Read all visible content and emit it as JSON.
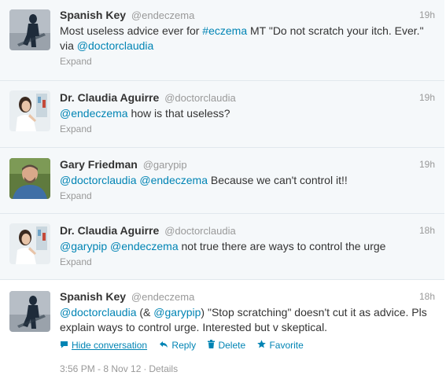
{
  "tweets": [
    {
      "fullname": "Spanish Key",
      "username": "@endeczema",
      "time": "19h",
      "parts": [
        {
          "t": "Most useless advice ever for ",
          "link": false
        },
        {
          "t": "#eczema",
          "link": true
        },
        {
          "t": " MT \"Do not scratch your itch. Ever.\" via ",
          "link": false
        },
        {
          "t": "@doctorclaudia",
          "link": true
        }
      ],
      "expand": "Expand"
    },
    {
      "fullname": "Dr. Claudia Aguirre",
      "username": "@doctorclaudia",
      "time": "19h",
      "parts": [
        {
          "t": "@endeczema",
          "link": true
        },
        {
          "t": " how is that useless?",
          "link": false
        }
      ],
      "expand": "Expand"
    },
    {
      "fullname": "Gary Friedman",
      "username": "@garypip",
      "time": "19h",
      "parts": [
        {
          "t": "@doctorclaudia",
          "link": true
        },
        {
          "t": " ",
          "link": false
        },
        {
          "t": "@endeczema",
          "link": true
        },
        {
          "t": " Because we can't control it!!",
          "link": false
        }
      ],
      "expand": "Expand"
    },
    {
      "fullname": "Dr. Claudia Aguirre",
      "username": "@doctorclaudia",
      "time": "18h",
      "parts": [
        {
          "t": "@garypip",
          "link": true
        },
        {
          "t": " ",
          "link": false
        },
        {
          "t": "@endeczema",
          "link": true
        },
        {
          "t": " not true there are ways to control the urge",
          "link": false
        }
      ],
      "expand": "Expand"
    },
    {
      "fullname": "Spanish Key",
      "username": "@endeczema",
      "time": "18h",
      "parts": [
        {
          "t": "@doctorclaudia",
          "link": true
        },
        {
          "t": " (& ",
          "link": false
        },
        {
          "t": "@garypip",
          "link": true
        },
        {
          "t": ") \"Stop scratching\" doesn't cut it as advice. Pls explain ways to control urge. Interested but v skeptical.",
          "link": false
        }
      ]
    }
  ],
  "actions": {
    "hide_conversation": "Hide conversation",
    "reply": "Reply",
    "delete": "Delete",
    "favorite": "Favorite"
  },
  "footer": {
    "timestamp": "3:56 PM - 8 Nov 12",
    "separator": "·",
    "details": "Details"
  },
  "icons": {
    "conversation": "speech-bubble-icon",
    "reply": "reply-arrow-icon",
    "delete": "trash-icon",
    "favorite": "star-icon"
  },
  "colors": {
    "link": "#0084b4",
    "muted": "#999999",
    "text": "#333333",
    "collapsed_bg": "#f5f8fa"
  }
}
